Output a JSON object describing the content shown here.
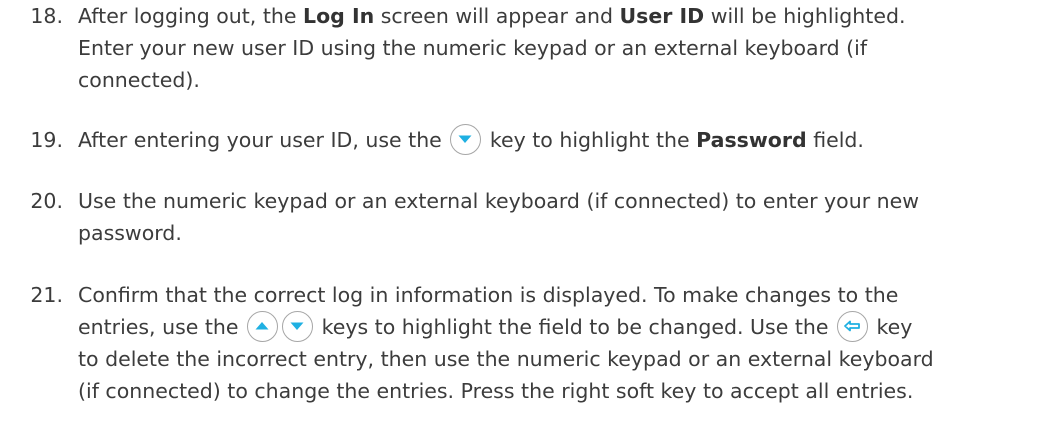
{
  "steps": [
    {
      "number": "18.",
      "line1": {
        "pre": "After logging out, the ",
        "bold1": "Log In",
        "mid": " screen will appear and ",
        "bold2": "User ID",
        "post": " will be highlighted."
      },
      "line2": "Enter your new user ID using the numeric keypad or an external keyboard (if",
      "line3": "connected)."
    },
    {
      "number": "19.",
      "line1": {
        "pre": "After entering your user ID, use the ",
        "icon": "down-arrow-key-icon",
        "mid": " key to highlight the ",
        "bold": "Password",
        "post": " field."
      }
    },
    {
      "number": "20.",
      "line1": "Use the numeric keypad or an external keyboard (if connected) to enter your new",
      "line2": "password."
    },
    {
      "number": "21.",
      "line1": "Confirm that the correct log in information is displayed. To make changes to the",
      "line2": {
        "pre": "entries, use the ",
        "icon1": "up-arrow-key-icon",
        "icon2": "down-arrow-key-icon",
        "mid": " keys to highlight the field to be changed. Use the ",
        "icon3": "backspace-key-icon",
        "post": " key"
      },
      "line3": "to delete the incorrect entry, then use the numeric keypad or an external keyboard",
      "line4": "(if connected) to change the entries. Press the right soft key to accept all entries."
    }
  ],
  "colors": {
    "text": "#3c3c3c",
    "key_border": "#a6a6a6",
    "key_symbol": "#1fb0e2"
  }
}
